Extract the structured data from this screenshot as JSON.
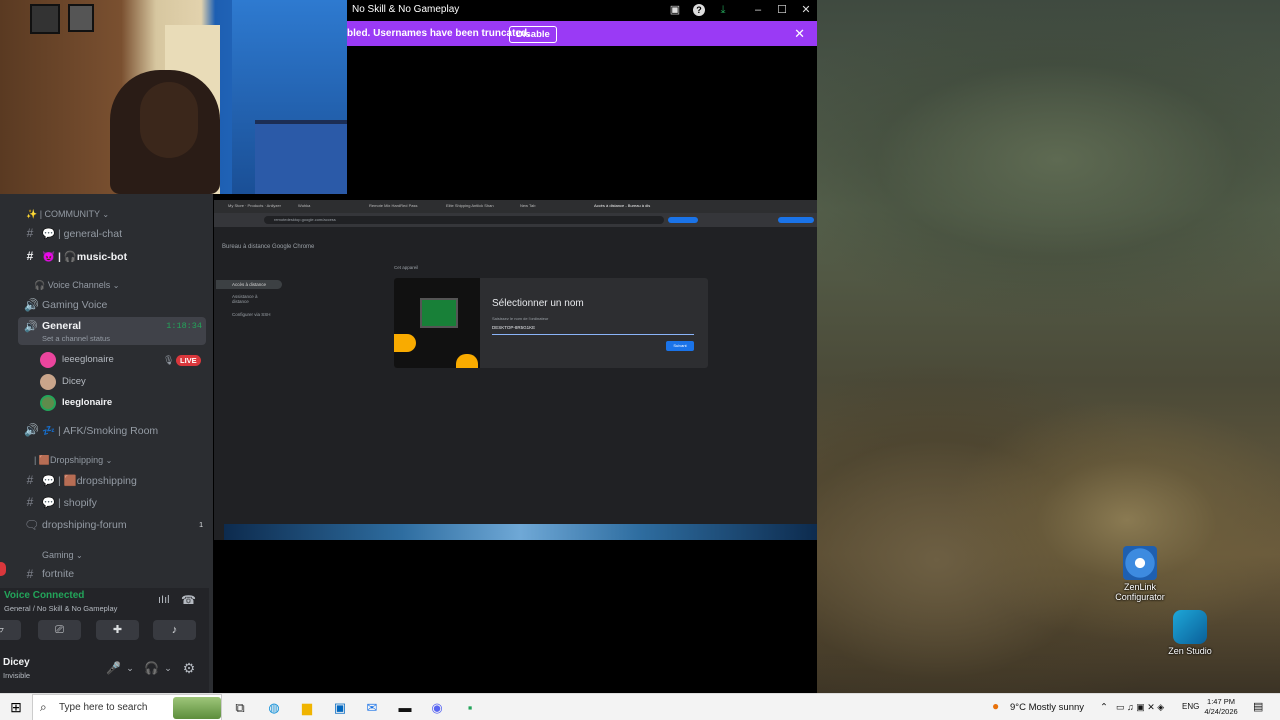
{
  "stream_window": {
    "title": "No Skill & No Gameplay",
    "banner_text": "bled. Usernames have been truncated.",
    "banner_button": "Disable",
    "colors": {
      "banner": "#9a3af5",
      "title_bar": "#000000"
    }
  },
  "discord": {
    "categories": {
      "community": "| COMMUNITY",
      "voice": "Voice Channels",
      "dropshipping": "| 🟫Dropshipping",
      "gaming": "Gaming"
    },
    "channels": {
      "general_chat": "| general-chat",
      "music_bot": "| 🎧music-bot",
      "gaming_voice": "Gaming Voice",
      "general": "General",
      "general_timer": "1:18:34",
      "channel_status": "Set a channel status",
      "afk": "| AFK/Smoking Room",
      "dropshipping": "| 🟫dropshipping",
      "shopify": "| shopify",
      "dropshipping_forum": "dropshiping-forum",
      "forum_count": "1",
      "fortnite": "fortnite"
    },
    "voice_users": [
      {
        "name": "leeeglonaire",
        "color": "#eb459e",
        "live": "LIVE"
      },
      {
        "name": "Dicey",
        "color": "#c9a58b"
      },
      {
        "name": "leeglonaire",
        "color": "#5f8b4c"
      }
    ],
    "voice_panel": {
      "status": "Voice Connected",
      "location": "General / No Skill & No Gameplay"
    },
    "user_panel": {
      "name": "Dicey",
      "status": "Invisible"
    },
    "accent_colors": {
      "sidebar": "#2b2d31",
      "connected": "#23a55a",
      "live": "#da373c"
    }
  },
  "remote_desktop": {
    "tabs": [
      "My Store · Products · Anilyzer",
      "Wuhka",
      "Remote Mix HardRed Pass",
      "Elite Shipping Antlick Shan",
      "New Tab",
      "Accès à distance - Bureau à dis"
    ],
    "url": "remotedesktop.google.com/access",
    "page_title": "Bureau à distance Google Chrome",
    "nav_items": [
      "Accès à distance",
      "Assistance à distance",
      "Configurer via SSH"
    ],
    "section_label": "Cet appareil",
    "dialog": {
      "heading": "Sélectionner un nom",
      "subtext": "Saisissez le nom de l'ordinateur",
      "input_value": "DESKTOP-8R5G1KE",
      "next_button": "Suivant"
    }
  },
  "desktop_icons": [
    {
      "label": "ZenLink Configurator",
      "icon": "zenlink-icon"
    },
    {
      "label": "Zen Studio",
      "icon": "zen-studio-icon"
    }
  ],
  "taskbar": {
    "search_placeholder": "Type here to search",
    "weather": "9°C  Mostly sunny",
    "language": "ENG",
    "time": "1:47 PM",
    "date": "4/24/2026"
  }
}
